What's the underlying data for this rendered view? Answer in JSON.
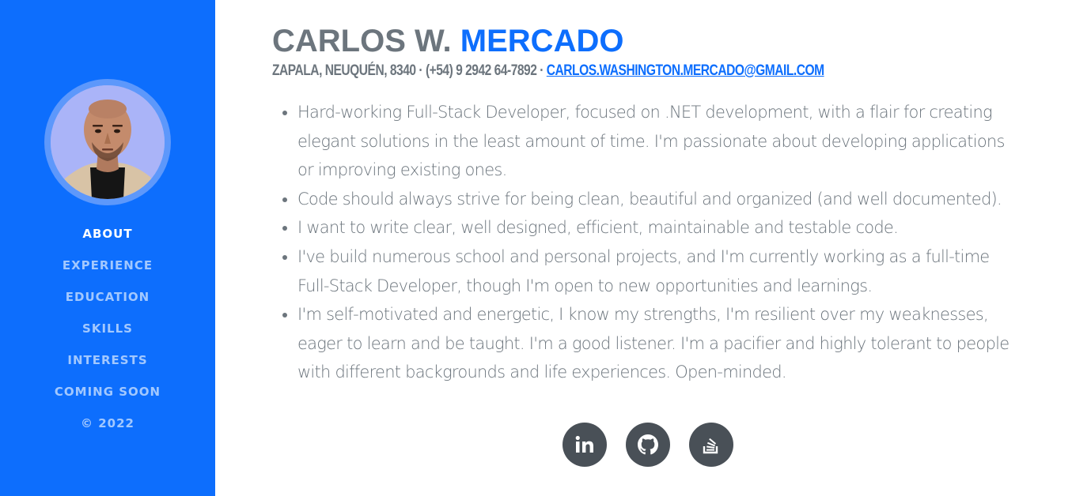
{
  "sidebar": {
    "avatar_alt": "profile photo",
    "nav": [
      {
        "label": "About",
        "active": true
      },
      {
        "label": "Experience",
        "active": false
      },
      {
        "label": "Education",
        "active": false
      },
      {
        "label": "Skills",
        "active": false
      },
      {
        "label": "Interests",
        "active": false
      },
      {
        "label": "Coming Soon",
        "active": false
      }
    ],
    "copyright": "© 2022"
  },
  "header": {
    "first_name": "CARLOS W.",
    "last_name": "MERCADO",
    "address": "ZAPALA, NEUQUÉN, 8340 · (+54) 9 2942 64-7892 ·",
    "email": "CARLOS.WASHINGTON.MERCADO@GMAIL.COM"
  },
  "about": {
    "bullets": [
      "Hard-working Full-Stack Developer, focused on .NET development, with a flair for creating elegant solutions in the least amount of time. I'm passionate about developing applications or improving existing ones.",
      "Code should always strive for being clean, beautiful and organized (and well documented).",
      "I want to write clear, well designed, efficient, maintainable and testable code.",
      "I've build numerous school and personal projects, and I'm currently working as a full-time Full-Stack Developer, though I'm open to new opportunities and learnings.",
      "I'm self-motivated and energetic, I know my strengths, I'm resilient over my weaknesses, eager to learn and be taught. I'm a good listener. I'm a pacifier and highly tolerant to people with different backgrounds and life experiences. Open-minded."
    ]
  },
  "socials": [
    {
      "icon": "linkedin-icon"
    },
    {
      "icon": "github-icon"
    },
    {
      "icon": "stackoverflow-icon"
    }
  ],
  "colors": {
    "primary": "#0d6efd",
    "text_muted": "#6c757d",
    "social_bg": "#495057"
  }
}
